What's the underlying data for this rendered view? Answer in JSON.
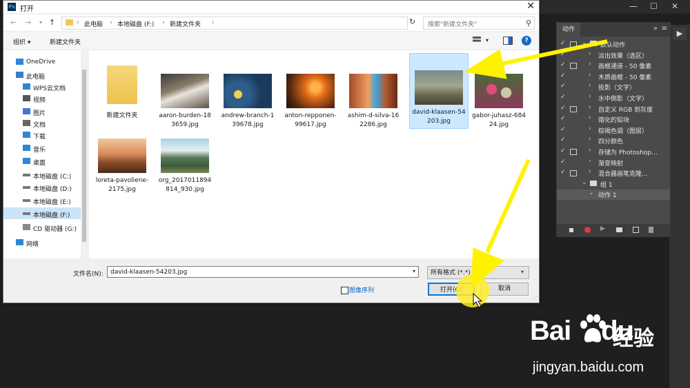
{
  "dialog": {
    "title": "打开",
    "app_icon": "Ps",
    "close_glyph": "✕",
    "breadcrumb": [
      "此电脑",
      "本地磁盘 (F:)",
      "新建文件夹"
    ],
    "search_placeholder": "搜索\"新建文件夹\"",
    "toolbar": {
      "organize": "组织 ▾",
      "new_folder": "新建文件夹"
    },
    "nav_items": [
      {
        "label": "OneDrive",
        "icon": "cloud-icon"
      },
      {
        "label": "此电脑",
        "icon": "computer-icon"
      },
      {
        "label": "WPS云文档",
        "icon": "cloud-icon"
      },
      {
        "label": "视频",
        "icon": "video-icon"
      },
      {
        "label": "图片",
        "icon": "picture-icon"
      },
      {
        "label": "文档",
        "icon": "document-icon"
      },
      {
        "label": "下载",
        "icon": "download-icon"
      },
      {
        "label": "音乐",
        "icon": "music-icon"
      },
      {
        "label": "桌面",
        "icon": "desktop-icon"
      },
      {
        "label": "本地磁盘 (C:)",
        "icon": "drive-icon"
      },
      {
        "label": "本地磁盘 (D:)",
        "icon": "drive-icon"
      },
      {
        "label": "本地磁盘 (E:)",
        "icon": "drive-icon"
      },
      {
        "label": "本地磁盘 (F:)",
        "icon": "drive-icon",
        "selected": true
      },
      {
        "label": "CD 驱动器 (G:)",
        "icon": "cd-icon"
      },
      {
        "label": "网络",
        "icon": "network-icon"
      }
    ],
    "files": [
      {
        "name": "新建文件夹",
        "type": "folder"
      },
      {
        "name": "aaron-burden-183659.jpg",
        "type": "image"
      },
      {
        "name": "andrew-branch-139678.jpg",
        "type": "image"
      },
      {
        "name": "anton-repponen-99617.jpg",
        "type": "image"
      },
      {
        "name": "ashim-d-silva-162286.jpg",
        "type": "image"
      },
      {
        "name": "david-klaasen-54203.jpg",
        "type": "image",
        "selected": true
      },
      {
        "name": "gabor-juhasz-68424.jpg",
        "type": "image"
      },
      {
        "name": "loreta-pavoliene-2175.jpg",
        "type": "image"
      },
      {
        "name": "org_2017011894814_930.jpg",
        "type": "image"
      }
    ],
    "filename_label": "文件名(N):",
    "filename_value": "david-klaasen-54203.jpg",
    "filetype_value": "所有格式 (*.*)",
    "image_sequence_label": "图像序列",
    "open_label": "打开(O)",
    "cancel_label": "取消"
  },
  "photoshop": {
    "minimize_glyph": "—",
    "restore_glyph": "☐",
    "close_glyph": "✕",
    "panel_tab": "动作",
    "panel_collapse": "»",
    "panel_menu": "≡",
    "actions": [
      {
        "label": "默认动作",
        "level": 0,
        "kind": "set"
      },
      {
        "label": "淡出效果（选区）",
        "level": 1,
        "kind": "action"
      },
      {
        "label": "画框通道 - 50 像素",
        "level": 1,
        "kind": "action"
      },
      {
        "label": "木质画框 - 50 像素",
        "level": 1,
        "kind": "action"
      },
      {
        "label": "投影（文字）",
        "level": 1,
        "kind": "action"
      },
      {
        "label": "水中倒影（文字）",
        "level": 1,
        "kind": "action"
      },
      {
        "label": "自定义 RGB 到灰度",
        "level": 1,
        "kind": "action"
      },
      {
        "label": "熔化的铅块",
        "level": 1,
        "kind": "action"
      },
      {
        "label": "棕褐色调（图层）",
        "level": 1,
        "kind": "action"
      },
      {
        "label": "四分颜色",
        "level": 1,
        "kind": "action"
      },
      {
        "label": "存储为 Photoshop...",
        "level": 1,
        "kind": "action"
      },
      {
        "label": "渐变映射",
        "level": 1,
        "kind": "action"
      },
      {
        "label": "混合器画笔克隆...",
        "level": 1,
        "kind": "action"
      },
      {
        "label": "组 1",
        "level": 0,
        "kind": "set"
      },
      {
        "label": "动作 1",
        "level": 1,
        "kind": "action",
        "selected": true
      }
    ]
  },
  "watermark": {
    "logo": "Bai",
    "logo_tail": "du",
    "brand_cn": "经验",
    "url": "jingyan.baidu.com"
  },
  "colors": {
    "accent_blue": "#0078d7",
    "selection": "#cce8ff",
    "arrow_yellow": "#fff200"
  }
}
